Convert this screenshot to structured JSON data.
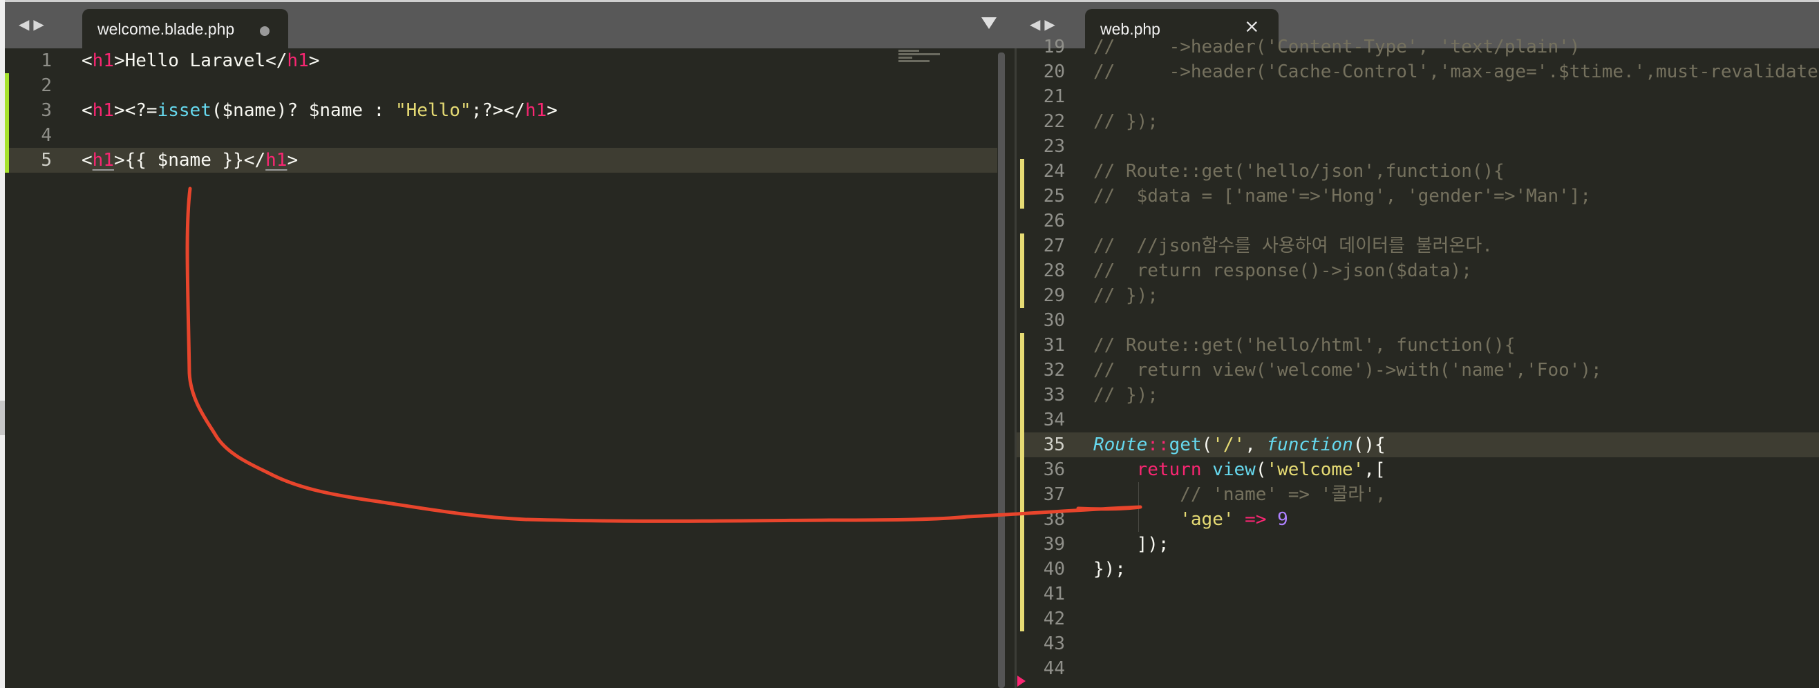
{
  "left_pane": {
    "nav": {
      "back_icon": "◀",
      "forward_icon": "▶"
    },
    "tab": {
      "label": "welcome.blade.php",
      "modified": true
    },
    "lines": [
      {
        "n": "1",
        "tokens": [
          [
            "pl",
            "<"
          ],
          [
            "kw",
            "h1"
          ],
          [
            "pl",
            ">Hello Laravel</"
          ],
          [
            "kw",
            "h1"
          ],
          [
            "pl",
            ">"
          ]
        ]
      },
      {
        "n": "2",
        "tokens": []
      },
      {
        "n": "3",
        "tokens": [
          [
            "pl",
            "<"
          ],
          [
            "kw",
            "h1"
          ],
          [
            "pl",
            "><?="
          ],
          [
            "fn",
            "isset"
          ],
          [
            "pl",
            "($name)? $name : "
          ],
          [
            "str",
            "\"Hello\""
          ],
          [
            "pl",
            ";?></"
          ],
          [
            "kw",
            "h1"
          ],
          [
            "pl",
            ">"
          ]
        ]
      },
      {
        "n": "4",
        "tokens": []
      },
      {
        "n": "5",
        "tokens": [
          [
            "pl",
            "<"
          ],
          [
            "kw ul",
            "h1"
          ],
          [
            "pl",
            ">{{ $name }}</"
          ],
          [
            "kw ul",
            "h1"
          ],
          [
            "pl",
            ">"
          ]
        ]
      }
    ]
  },
  "right_pane": {
    "nav": {
      "back_icon": "◀",
      "forward_icon": "▶"
    },
    "tab": {
      "label": "web.php",
      "close_icon": "×"
    },
    "lines": [
      {
        "n": "19",
        "tokens": [
          [
            "cm",
            "//     ->header('Content-Type', 'text/plain')"
          ]
        ]
      },
      {
        "n": "20",
        "tokens": [
          [
            "cm",
            "//     ->header('Cache-Control','max-age='.$ttime.',must-revalidate');"
          ]
        ]
      },
      {
        "n": "21",
        "tokens": []
      },
      {
        "n": "22",
        "tokens": [
          [
            "cm",
            "// });"
          ]
        ]
      },
      {
        "n": "23",
        "tokens": []
      },
      {
        "n": "24",
        "tokens": [
          [
            "cm",
            "// Route::get('hello/json',function(){"
          ]
        ]
      },
      {
        "n": "25",
        "tokens": [
          [
            "cm",
            "//  $data = ['name'=>'Hong', 'gender'=>'Man'];"
          ]
        ]
      },
      {
        "n": "26",
        "tokens": []
      },
      {
        "n": "27",
        "tokens": [
          [
            "cm",
            "//  //json함수를 사용하여 데이터를 불러온다."
          ]
        ]
      },
      {
        "n": "28",
        "tokens": [
          [
            "cm",
            "//  return response()->json($data);"
          ]
        ]
      },
      {
        "n": "29",
        "tokens": [
          [
            "cm",
            "// });"
          ]
        ]
      },
      {
        "n": "30",
        "tokens": []
      },
      {
        "n": "31",
        "tokens": [
          [
            "cm",
            "// Route::get('hello/html', function(){"
          ]
        ]
      },
      {
        "n": "32",
        "tokens": [
          [
            "cm",
            "//  return view('welcome')->with('name','Foo');"
          ]
        ]
      },
      {
        "n": "33",
        "tokens": [
          [
            "cm",
            "// });"
          ]
        ]
      },
      {
        "n": "34",
        "tokens": []
      },
      {
        "n": "35",
        "tokens": [
          [
            "it",
            "Route"
          ],
          [
            "kw",
            "::"
          ],
          [
            "fn",
            "get"
          ],
          [
            "pl",
            "("
          ],
          [
            "str",
            "'/'"
          ],
          [
            "pl",
            ", "
          ],
          [
            "it",
            "function"
          ],
          [
            "pl",
            "(){"
          ]
        ]
      },
      {
        "n": "36",
        "tokens": [
          [
            "pl",
            "    "
          ],
          [
            "kw",
            "return"
          ],
          [
            "pl",
            " "
          ],
          [
            "fn",
            "view"
          ],
          [
            "pl",
            "("
          ],
          [
            "str",
            "'welcome'"
          ],
          [
            "pl",
            ",["
          ]
        ]
      },
      {
        "n": "37",
        "tokens": [
          [
            "pl",
            "        "
          ],
          [
            "cm",
            "// 'name' => '콜라',"
          ]
        ]
      },
      {
        "n": "38",
        "tokens": [
          [
            "pl",
            "        "
          ],
          [
            "str",
            "'age'"
          ],
          [
            "pl",
            " "
          ],
          [
            "kw",
            "=>"
          ],
          [
            "pl",
            " "
          ],
          [
            "num",
            "9"
          ]
        ]
      },
      {
        "n": "39",
        "tokens": [
          [
            "pl",
            "    ]);"
          ]
        ]
      },
      {
        "n": "40",
        "tokens": [
          [
            "pl",
            "});"
          ]
        ]
      },
      {
        "n": "41",
        "tokens": []
      },
      {
        "n": "42",
        "tokens": []
      },
      {
        "n": "43",
        "tokens": []
      },
      {
        "n": "44",
        "tokens": []
      }
    ]
  },
  "colors": {
    "background": "#272822",
    "keyword": "#f92672",
    "function": "#66d9ef",
    "string": "#e6db74",
    "number": "#ae81ff",
    "comment": "#75715e",
    "annotation_stroke": "#e8452c"
  }
}
